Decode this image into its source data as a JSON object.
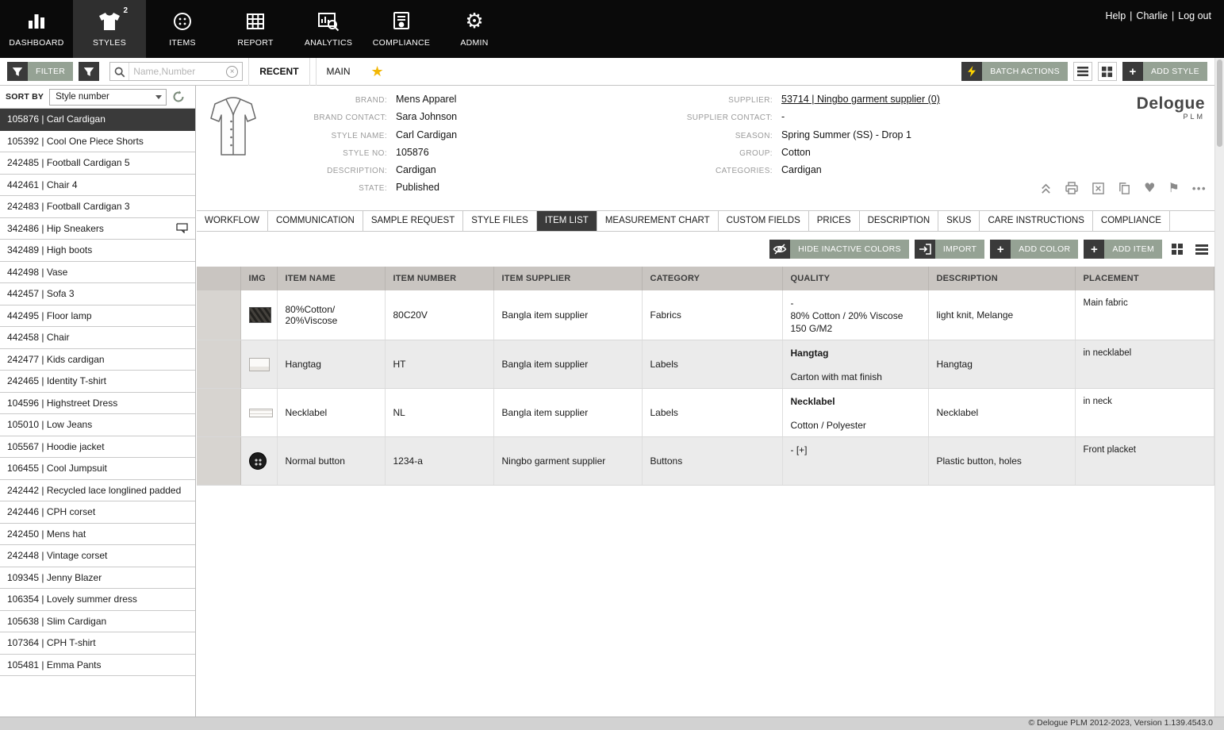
{
  "topnav": {
    "sep": "|",
    "help_label": "Help",
    "user_name": "Charlie",
    "logout_label": "Log out",
    "items": [
      {
        "label": "DASHBOARD"
      },
      {
        "label": "STYLES",
        "badge": "2",
        "active": true
      },
      {
        "label": "ITEMS"
      },
      {
        "label": "REPORT"
      },
      {
        "label": "ANALYTICS"
      },
      {
        "label": "COMPLIANCE"
      },
      {
        "label": "ADMIN"
      }
    ]
  },
  "toolbar": {
    "filter_label": "FILTER",
    "search_placeholder": "Name,Number",
    "tabs": [
      {
        "label": "RECENT",
        "active": true
      },
      {
        "label": "MAIN",
        "active": false
      }
    ],
    "batch_actions_label": "BATCH ACTIONS",
    "add_style_label": "ADD STYLE"
  },
  "sidebar": {
    "sort_by_label": "SORT BY",
    "sort_value": "Style number",
    "items": [
      {
        "label": "105876 | Carl Cardigan",
        "selected": true
      },
      {
        "label": "105392 | Cool One Piece Shorts"
      },
      {
        "label": "242485 | Football Cardigan 5"
      },
      {
        "label": "442461 | Chair 4"
      },
      {
        "label": "242483 | Football Cardigan 3"
      },
      {
        "label": "342486 | Hip Sneakers",
        "has_comment": true
      },
      {
        "label": "342489 | High boots"
      },
      {
        "label": "442498 | Vase"
      },
      {
        "label": "442457 | Sofa 3"
      },
      {
        "label": "442495 | Floor lamp"
      },
      {
        "label": "442458 | Chair"
      },
      {
        "label": "242477 | Kids cardigan"
      },
      {
        "label": "242465 | Identity T-shirt"
      },
      {
        "label": "104596 | Highstreet Dress"
      },
      {
        "label": "105010 | Low Jeans"
      },
      {
        "label": "105567 | Hoodie jacket"
      },
      {
        "label": "106455 | Cool Jumpsuit"
      },
      {
        "label": "242442 | Recycled lace longlined padded"
      },
      {
        "label": "242446 | CPH corset"
      },
      {
        "label": "242450 | Mens hat"
      },
      {
        "label": "242448 | Vintage corset"
      },
      {
        "label": "109345 | Jenny Blazer"
      },
      {
        "label": "106354 | Lovely summer dress"
      },
      {
        "label": "105638 | Slim Cardigan"
      },
      {
        "label": "107364 | CPH T-shirt"
      },
      {
        "label": "105481 | Emma Pants"
      }
    ]
  },
  "style_header": {
    "fields_left": [
      {
        "label": "BRAND:",
        "value": "Mens Apparel"
      },
      {
        "label": "BRAND CONTACT:",
        "value": "Sara Johnson"
      },
      {
        "label": "STYLE NAME:",
        "value": "Carl Cardigan"
      },
      {
        "label": "STYLE NO:",
        "value": "105876"
      },
      {
        "label": "DESCRIPTION:",
        "value": "Cardigan"
      },
      {
        "label": "STATE:",
        "value": "Published"
      }
    ],
    "fields_right": [
      {
        "label": "SUPPLIER:",
        "value": "53714 | Ningbo garment supplier (0)",
        "link": true
      },
      {
        "label": "SUPPLIER CONTACT:",
        "value": "-"
      },
      {
        "label": "SEASON:",
        "value": "Spring Summer (SS) - Drop 1"
      },
      {
        "label": "GROUP:",
        "value": "Cotton"
      },
      {
        "label": "CATEGORIES:",
        "value": "Cardigan"
      }
    ],
    "logo_text": "Delogue",
    "logo_sub": "PLM"
  },
  "style_tabs": [
    {
      "label": "WORKFLOW"
    },
    {
      "label": "COMMUNICATION"
    },
    {
      "label": "SAMPLE REQUEST"
    },
    {
      "label": "STYLE FILES"
    },
    {
      "label": "ITEM LIST",
      "active": true
    },
    {
      "label": "MEASUREMENT CHART"
    },
    {
      "label": "CUSTOM FIELDS"
    },
    {
      "label": "PRICES"
    },
    {
      "label": "DESCRIPTION"
    },
    {
      "label": "SKUS"
    },
    {
      "label": "CARE INSTRUCTIONS"
    },
    {
      "label": "COMPLIANCE"
    }
  ],
  "item_toolbar": {
    "hide_inactive_label": "HIDE INACTIVE COLORS",
    "import_label": "IMPORT",
    "add_color_label": "ADD COLOR",
    "add_item_label": "ADD ITEM"
  },
  "item_table": {
    "columns": [
      "IMG",
      "ITEM NAME",
      "ITEM NUMBER",
      "ITEM SUPPLIER",
      "CATEGORY",
      "QUALITY",
      "DESCRIPTION",
      "PLACEMENT"
    ],
    "rows": [
      {
        "thumb": "fabric",
        "name": "80%Cotton/ 20%Viscose",
        "number": "80C20V",
        "supplier": "Bangla item supplier",
        "category": "Fabrics",
        "quality_lines": [
          "-",
          "80% Cotton / 20% Viscose",
          "150 G/M2"
        ],
        "description": "light knit, Melange",
        "placement": "Main fabric"
      },
      {
        "thumb": "hangtag",
        "name": "Hangtag",
        "number": "HT",
        "supplier": "Bangla item supplier",
        "category": "Labels",
        "quality_title": "Hangtag",
        "quality_lines": [
          "Carton with mat finish"
        ],
        "description": "Hangtag",
        "placement": "in necklabel"
      },
      {
        "thumb": "necklabel",
        "name": "Necklabel",
        "number": "NL",
        "supplier": "Bangla item supplier",
        "category": "Labels",
        "quality_title": "Necklabel",
        "quality_lines": [
          "Cotton / Polyester"
        ],
        "description": "Necklabel",
        "placement": "in neck"
      },
      {
        "thumb": "button",
        "name": "Normal button",
        "number": "1234-a",
        "supplier": "Ningbo garment supplier",
        "category": "Buttons",
        "quality_lines": [
          "- [+]"
        ],
        "description": "Plastic button, holes",
        "placement": "Front placket"
      }
    ]
  },
  "footer": {
    "text": "© Delogue PLM 2012-2023, Version 1.139.4543.0"
  }
}
